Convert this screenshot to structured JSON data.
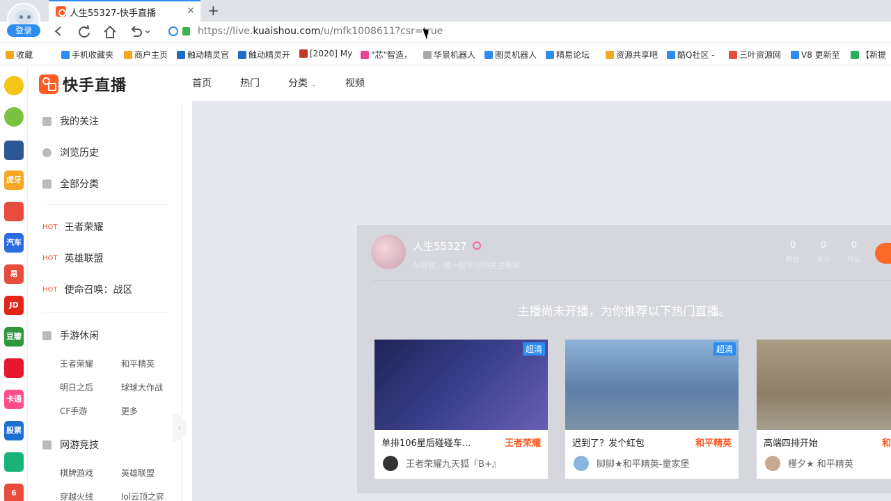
{
  "browser": {
    "login_label": "登录",
    "tab_title": "人生55327-快手直播",
    "tab_close": "×",
    "new_tab": "+",
    "url_prefix": "https://live.",
    "url_domain": "kuaishou.com",
    "url_path": "/u/mfk1008611?csr=true",
    "nav_icons": [
      "back-icon",
      "reload-icon",
      "home-icon",
      "undo-icon"
    ],
    "bookmarks": [
      {
        "label": "收藏",
        "color": "#f5a623"
      },
      {
        "label": "手机收藏夹",
        "color": "#2d8cf0"
      },
      {
        "label": "商户主页",
        "color": "#f5a623"
      },
      {
        "label": "触动精灵官",
        "color": "#1b6ec2"
      },
      {
        "label": "触动精灵开",
        "color": "#1b6ec2"
      },
      {
        "label": "[2020] My",
        "color": "#c0392b"
      },
      {
        "label": "\"芯\"智造，",
        "color": "#e84393"
      },
      {
        "label": "华景机器人",
        "color": "#aaaaaa"
      },
      {
        "label": "图灵机器人",
        "color": "#2d8cf0"
      },
      {
        "label": "精易论坛",
        "color": "#2d8cf0"
      },
      {
        "label": "资源共享吧",
        "color": "#f5a623"
      },
      {
        "label": "酷Q社区 -",
        "color": "#2d8cf0"
      },
      {
        "label": "三叶资源网",
        "color": "#e74c3c"
      },
      {
        "label": "V8 更新至",
        "color": "#2d8cf0"
      },
      {
        "label": "【新提",
        "color": "#27ae60"
      }
    ],
    "sidebar_icons": [
      {
        "name": "favorites-star-icon",
        "label": "",
        "color": "#f5c518"
      },
      {
        "name": "history-clock-icon",
        "label": "",
        "color": "#7cc242"
      },
      {
        "name": "word-doc-icon",
        "label": "",
        "color": "#2b5797"
      },
      {
        "name": "huya-app-icon",
        "label": "虎牙",
        "color": "#f5a623"
      },
      {
        "name": "chrome-app-icon",
        "label": "",
        "color": "#e74c3c"
      },
      {
        "name": "auto-app-icon",
        "label": "汽车",
        "color": "#2d6cdf"
      },
      {
        "name": "yi-app-icon",
        "label": "易",
        "color": "#e74c3c"
      },
      {
        "name": "jd-app-icon",
        "label": "JD",
        "color": "#e1251b"
      },
      {
        "name": "douban-app-icon",
        "label": "豆瓣",
        "color": "#2e963d"
      },
      {
        "name": "weibo-app-icon",
        "label": "",
        "color": "#e6162d"
      },
      {
        "name": "card-app-icon",
        "label": "卡通",
        "color": "#ff4f8b"
      },
      {
        "name": "stocks-app-icon",
        "label": "股票",
        "color": "#1f6fd1"
      },
      {
        "name": "money-app-icon",
        "label": "",
        "color": "#19b37a"
      },
      {
        "name": "six-app-icon",
        "label": "6",
        "color": "#e74c3c"
      }
    ]
  },
  "site": {
    "logo_text": "快手直播",
    "nav": [
      "首页",
      "热门",
      "分类",
      "视频"
    ],
    "nav_dropdown_caret": "⌄"
  },
  "leftnav": {
    "main": [
      {
        "label": "我的关注",
        "icon": "heart-shield-icon"
      },
      {
        "label": "浏览历史",
        "icon": "clock-icon"
      },
      {
        "label": "全部分类",
        "icon": "grid-icon"
      }
    ],
    "hot_tag": "HOT",
    "hot": [
      "王者荣耀",
      "英雄联盟",
      "使命召唤：战区"
    ],
    "mobile_group": "手游休闲",
    "mobile_items": [
      "王者荣耀",
      "和平精英",
      "明日之后",
      "球球大作战",
      "CF手游",
      "更多"
    ],
    "pc_group": "网游竞技",
    "pc_items": [
      "棋牌游戏",
      "英雄联盟",
      "穿越火线",
      "lol云顶之弈"
    ],
    "collapse_arrow": "‹"
  },
  "channel": {
    "name": "人生55327",
    "desc": "AI有效，做一起学习的关注哦嘛",
    "stats": [
      {
        "num": "0",
        "label": "粉丝"
      },
      {
        "num": "0",
        "label": "关注"
      },
      {
        "num": "0",
        "label": "作品"
      }
    ],
    "notice": "主播尚未开播，为你推荐以下热门直播。"
  },
  "recommend": [
    {
      "title": "单排106星后碰碰车...",
      "category": "王者荣耀",
      "user": "王者荣耀九天狐『B+』",
      "badge": "超清",
      "thumb": "#2a2e6e"
    },
    {
      "title": "迟到了？发个红包",
      "category": "和平精英",
      "user": "脚脚★和平精英-童家堡",
      "badge": "超清",
      "thumb": "#5f7fa8"
    },
    {
      "title": "高端四排开始",
      "category": "和",
      "user": "槿夕★ 和平精英",
      "badge": "",
      "thumb": "#9a8f7a"
    }
  ]
}
